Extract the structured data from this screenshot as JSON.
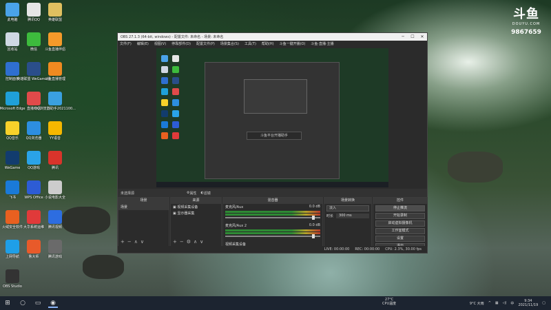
{
  "desktop": {
    "icons": [
      {
        "label": "此电脑",
        "color": "#4aa3e8"
      },
      {
        "label": "腾讯QQ",
        "color": "#e6e6e6"
      },
      {
        "label": "英雄联盟",
        "color": "#e0c060"
      },
      {
        "label": "回收站",
        "color": "#cfd8e3"
      },
      {
        "label": "微信",
        "color": "#3dbb3d"
      },
      {
        "label": "斗鱼直播伴侣",
        "color": "#f59a2a"
      },
      {
        "label": "控制面板",
        "color": "#2f6fd0"
      },
      {
        "label": "英雄联盟 WeGame版",
        "color": "#2a4e8a"
      },
      {
        "label": "斗鱼直播管理",
        "color": "#f08a20"
      },
      {
        "label": "Microsoft Edge",
        "color": "#1fa0d8"
      },
      {
        "label": "直播伴侣",
        "color": "#e04a4a"
      },
      {
        "label": "QQ浏览器助手2021100...",
        "color": "#3aa0e0"
      },
      {
        "label": "QQ音乐",
        "color": "#f7d12a"
      },
      {
        "label": "QQ浏览器",
        "color": "#2d8ee0"
      },
      {
        "label": "YY语音",
        "color": "#f5b700"
      },
      {
        "label": "WeGame",
        "color": "#123c6e"
      },
      {
        "label": "QQ游戏",
        "color": "#2aa3e8"
      },
      {
        "label": "腾讯",
        "color": "#d9342b"
      },
      {
        "label": "飞书",
        "color": "#1a7ad8"
      },
      {
        "label": "WPS Office",
        "color": "#2d5cd5"
      },
      {
        "label": "小说电影大全",
        "color": "#cccccc"
      },
      {
        "label": "火绒安全软件",
        "color": "#e86020"
      },
      {
        "label": "大华系统运维",
        "color": "#e03a3a"
      },
      {
        "label": "腾讯视频",
        "color": "#2d6de0"
      },
      {
        "label": "上网导航",
        "color": "#1f9fe8"
      },
      {
        "label": "鲁大师",
        "color": "#e85a2a"
      },
      {
        "label": "腾讯游戏",
        "color": "#6a6a6a"
      },
      {
        "label": "OBS Studio",
        "color": "#333333"
      }
    ]
  },
  "watermark": {
    "brand": "斗鱼",
    "sub": "DOUYU.COM",
    "room": "9867659"
  },
  "obs": {
    "title": "OBS 27.1.3 (64-bit, windows) - 配置文件: 未命名 - 场景: 未命名",
    "menu": [
      "文件(F)",
      "编辑(E)",
      "视图(V)",
      "停靠部件(D)",
      "配置文件(P)",
      "场景集合(S)",
      "工具(T)",
      "帮助(H)",
      "斗鱼一键开播(O)",
      "斗鱼·直播·主播"
    ],
    "source_selected": "未选择源",
    "scene_bar": {
      "props": "属性",
      "filters": "滤镜"
    },
    "docks": {
      "scenes": {
        "title": "场景",
        "items": [
          "场景"
        ]
      },
      "sources": {
        "title": "来源",
        "items": [
          "视频采集设备",
          "显示器采集"
        ]
      },
      "mixer": {
        "title": "混音器",
        "ch1": "麦克风/Aux",
        "ch1_val": "0.0 dB",
        "ch2": "麦克风/Aux 2",
        "ch2_val": "0.0 dB",
        "ch3": "视频采集设备"
      },
      "transitions": {
        "title": "场景转换",
        "type": "淡入",
        "duration_label": "时长",
        "duration": "300 ms"
      },
      "controls": {
        "title": "控件",
        "buttons": [
          "停止推流",
          "开始录制",
          "启动虚拟摄像机",
          "工作室模式",
          "设置",
          "退出"
        ]
      }
    },
    "status": {
      "live": "LIVE: 00:00:00",
      "rec": "REC: 00:00:00",
      "cpu": "CPU: 2.3%, 30.00 fps"
    },
    "preview_popup": "斗鱼平台开播助手"
  },
  "taskbar": {
    "weather": {
      "temp": "27°C",
      "desc": "CPU温度"
    },
    "tray": {
      "weather": "9°C 大雨",
      "lang": "中",
      "time": "9:34",
      "date": "2021/11/19"
    }
  }
}
